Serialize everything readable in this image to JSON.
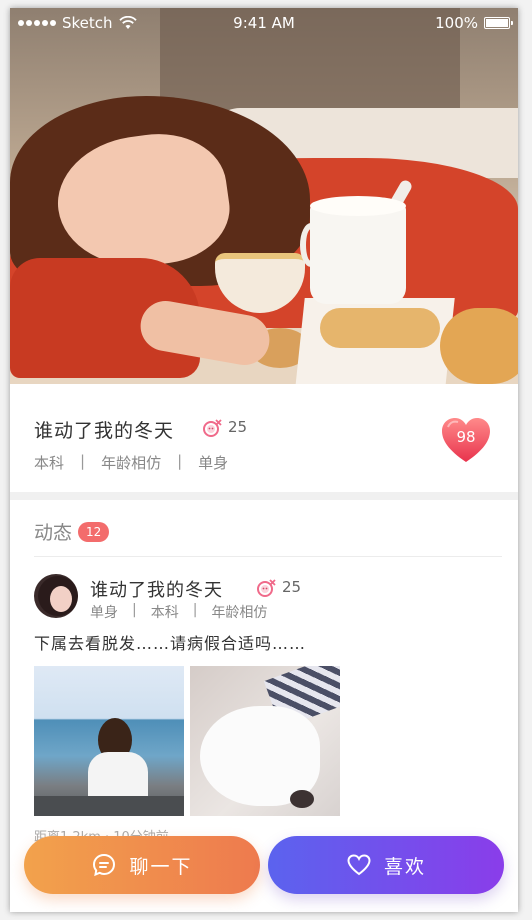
{
  "status_bar": {
    "carrier": "Sketch",
    "time": "9:41 AM",
    "battery": "100%"
  },
  "profile": {
    "name": "谁动了我的冬天",
    "age": "25",
    "tags": [
      "本科",
      "年龄相仿",
      "单身"
    ],
    "score": "98"
  },
  "moments": {
    "title": "动态",
    "count": "12",
    "post": {
      "name": "谁动了我的冬天",
      "age": "25",
      "tags": [
        "单身",
        "本科",
        "年龄相仿"
      ],
      "text": "下属去看脱发……请病假合适吗……",
      "meta": "距离1.2km · 10分钟前"
    }
  },
  "actions": {
    "chat_label": "聊一下",
    "like_label": "喜欢"
  },
  "colors": {
    "accent_red": "#f36c6c",
    "chat_gradient": [
      "#f2a24c",
      "#ee7a4e"
    ],
    "like_gradient": [
      "#5b63ee",
      "#8a3dea"
    ]
  },
  "icons": {
    "female": "female-icon",
    "heart": "heart-icon",
    "chat": "chat-bubble-icon",
    "wifi": "wifi-icon",
    "battery": "battery-icon"
  }
}
